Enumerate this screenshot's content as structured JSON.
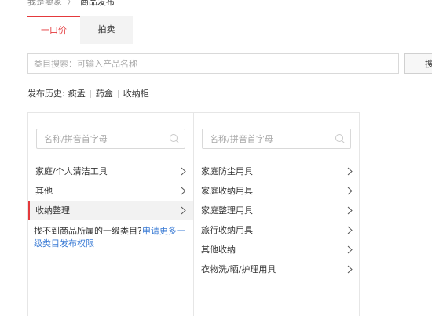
{
  "breadcrumb": {
    "root": "我是卖家",
    "separator": "〉",
    "current": "商品发布"
  },
  "tabs": [
    {
      "label": "一口价",
      "active": true
    },
    {
      "label": "拍卖",
      "active": false
    }
  ],
  "search": {
    "placeholder": "类目搜索：可输入产品名称",
    "button_label": "搜索"
  },
  "history": {
    "label": "发布历史:",
    "items": [
      "痰盂",
      "药盒",
      "收纳柜"
    ]
  },
  "column1": {
    "filter_placeholder": "名称/拼音首字母",
    "items": [
      "家庭/个人清洁工具",
      "其他",
      "收纳整理"
    ],
    "selected_index": 2,
    "notice_text": "找不到商品所属的一级类目?",
    "notice_link": "申请更多一级类目发布权限"
  },
  "column2": {
    "filter_placeholder": "名称/拼音首字母",
    "items": [
      "家庭防尘用具",
      "家庭收纳用具",
      "家庭整理用具",
      "旅行收纳用具",
      "其他收纳",
      "衣物洗/晒/护理用具"
    ]
  },
  "colors": {
    "accent": "#e4393c",
    "link": "#3a7bd5",
    "selected_bg": "#f2f2f2"
  }
}
